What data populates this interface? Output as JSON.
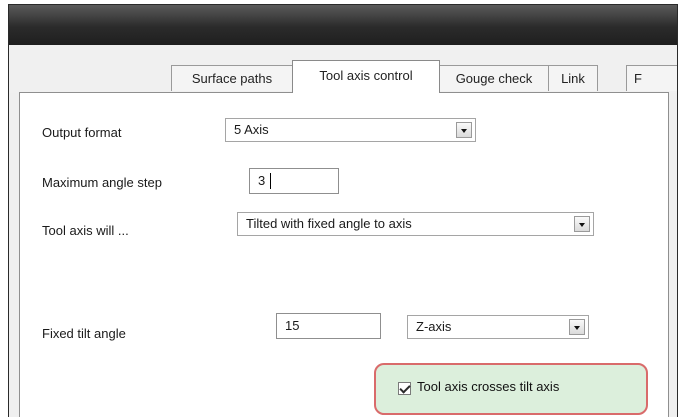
{
  "tabs": [
    {
      "label": "Surface paths",
      "active": false
    },
    {
      "label": "Tool axis control",
      "active": true
    },
    {
      "label": "Gouge check",
      "active": false
    },
    {
      "label": "Link",
      "active": false
    },
    {
      "label": "F",
      "active": false
    }
  ],
  "form": {
    "output_format": {
      "label": "Output format",
      "value": "5 Axis"
    },
    "max_angle_step": {
      "label": "Maximum angle step",
      "value": "3"
    },
    "tool_axis_will": {
      "label": "Tool axis will ...",
      "value": "Tilted with fixed angle to axis"
    },
    "fixed_tilt_angle": {
      "label": "Fixed tilt angle",
      "value": "15",
      "axis": "Z-axis"
    },
    "crosses_tilt_axis": {
      "label": "Tool axis crosses tilt axis",
      "checked": true
    }
  },
  "colors": {
    "highlight_border": "#d96b6b",
    "highlight_fill": "#dcefdc",
    "titlebar": "#2b2b2b"
  }
}
